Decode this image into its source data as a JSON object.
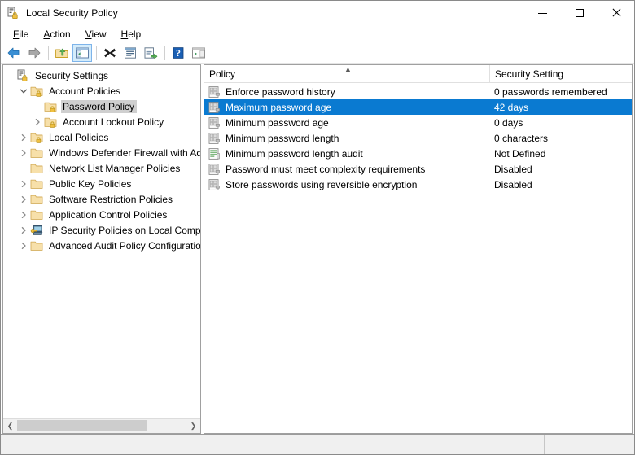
{
  "window": {
    "title": "Local Security Policy",
    "icon": "security-policy-icon",
    "controls": {
      "minimize": "Minimize",
      "maximize": "Maximize",
      "close": "Close"
    }
  },
  "menubar": {
    "items": [
      {
        "label": "File",
        "accel": "F"
      },
      {
        "label": "Action",
        "accel": "A"
      },
      {
        "label": "View",
        "accel": "V"
      },
      {
        "label": "Help",
        "accel": "H"
      }
    ]
  },
  "toolbar": {
    "buttons": [
      {
        "name": "back-button",
        "icon": "arrow-left-icon",
        "active": false
      },
      {
        "name": "forward-button",
        "icon": "arrow-right-icon",
        "active": false
      },
      {
        "name": "up-one-level-button",
        "icon": "folder-up-icon",
        "active": false
      },
      {
        "name": "show-hide-console-tree-button",
        "icon": "console-tree-icon",
        "active": true
      },
      {
        "name": "delete-button",
        "icon": "delete-x-icon",
        "active": false
      },
      {
        "name": "properties-button",
        "icon": "properties-icon",
        "active": false
      },
      {
        "name": "export-list-button",
        "icon": "export-list-icon",
        "active": false
      },
      {
        "name": "help-button",
        "icon": "help-question-icon",
        "active": false
      },
      {
        "name": "show-action-pane-button",
        "icon": "action-pane-icon",
        "active": false
      }
    ]
  },
  "tree": {
    "items": [
      {
        "label": "Security Settings",
        "indent": 0,
        "twisty": "none",
        "icon": "security-settings-icon",
        "selected": false
      },
      {
        "label": "Account Policies",
        "indent": 1,
        "twisty": "expanded",
        "icon": "folder-lock-icon",
        "selected": false
      },
      {
        "label": "Password Policy",
        "indent": 2,
        "twisty": "none",
        "icon": "folder-lock-icon",
        "selected": true
      },
      {
        "label": "Account Lockout Policy",
        "indent": 2,
        "twisty": "collapsed",
        "icon": "folder-lock-icon",
        "selected": false
      },
      {
        "label": "Local Policies",
        "indent": 1,
        "twisty": "collapsed",
        "icon": "folder-lock-icon",
        "selected": false
      },
      {
        "label": "Windows Defender Firewall with Adva",
        "indent": 1,
        "twisty": "collapsed",
        "icon": "folder-icon",
        "selected": false
      },
      {
        "label": "Network List Manager Policies",
        "indent": 1,
        "twisty": "none",
        "icon": "folder-icon",
        "selected": false
      },
      {
        "label": "Public Key Policies",
        "indent": 1,
        "twisty": "collapsed",
        "icon": "folder-icon",
        "selected": false
      },
      {
        "label": "Software Restriction Policies",
        "indent": 1,
        "twisty": "collapsed",
        "icon": "folder-icon",
        "selected": false
      },
      {
        "label": "Application Control Policies",
        "indent": 1,
        "twisty": "collapsed",
        "icon": "folder-icon",
        "selected": false
      },
      {
        "label": "IP Security Policies on Local Compute",
        "indent": 1,
        "twisty": "collapsed",
        "icon": "ip-security-icon",
        "selected": false
      },
      {
        "label": "Advanced Audit Policy Configuration",
        "indent": 1,
        "twisty": "collapsed",
        "icon": "folder-icon",
        "selected": false
      }
    ]
  },
  "list": {
    "columns": [
      {
        "label": "Policy",
        "sort": "ascending"
      },
      {
        "label": "Security Setting",
        "sort": "none"
      }
    ],
    "rows": [
      {
        "policy": "Enforce password history",
        "setting": "0 passwords remembered",
        "icon": "policy-setting-icon",
        "selected": false
      },
      {
        "policy": "Maximum password age",
        "setting": "42 days",
        "icon": "policy-setting-icon",
        "selected": true
      },
      {
        "policy": "Minimum password age",
        "setting": "0 days",
        "icon": "policy-setting-icon",
        "selected": false
      },
      {
        "policy": "Minimum password length",
        "setting": "0 characters",
        "icon": "policy-setting-icon",
        "selected": false
      },
      {
        "policy": "Minimum password length audit",
        "setting": "Not Defined",
        "icon": "policy-audit-icon",
        "selected": false
      },
      {
        "policy": "Password must meet complexity requirements",
        "setting": "Disabled",
        "icon": "policy-setting-icon",
        "selected": false
      },
      {
        "policy": "Store passwords using reversible encryption",
        "setting": "Disabled",
        "icon": "policy-setting-icon",
        "selected": false
      }
    ]
  },
  "statusbar": {
    "segments": [
      "",
      "",
      ""
    ]
  },
  "colors": {
    "selection_blue": "#0a7ad1",
    "tree_selection_gray": "#cfcfcf",
    "toolbar_active": "#d4ecfb",
    "folder_gold": "#f5d08a",
    "status_bg": "#f0f0f0"
  }
}
